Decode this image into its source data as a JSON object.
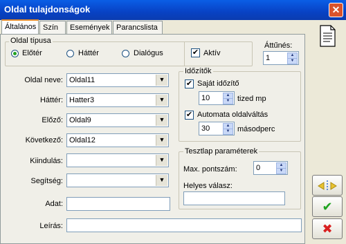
{
  "window": {
    "title": "Oldal tulajdonságok"
  },
  "tabs": [
    "Általános",
    "Szín",
    "Események",
    "Parancslista"
  ],
  "page_type": {
    "legend": "Oldal típusa",
    "options": [
      "Előtér",
      "Háttér",
      "Dialógus"
    ],
    "selected": "Előtér",
    "active_label": "Aktív"
  },
  "fade": {
    "label": "Áttűnés:",
    "value": "1"
  },
  "fields": {
    "page_name": {
      "label": "Oldal neve:",
      "value": "Oldal11"
    },
    "background": {
      "label": "Háttér:",
      "value": "Hatter3"
    },
    "previous": {
      "label": "Előző:",
      "value": "Oldal9"
    },
    "next": {
      "label": "Következő:",
      "value": "Oldal12"
    },
    "start": {
      "label": "Kiindulás:",
      "value": ""
    },
    "help": {
      "label": "Segítség:",
      "value": ""
    },
    "data": {
      "label": "Adat:",
      "value": ""
    },
    "description": {
      "label": "Leírás:",
      "value": ""
    }
  },
  "timers": {
    "legend": "Időzítők",
    "own_timer": {
      "label": "Saját időzítő",
      "checked": true,
      "value": "10",
      "unit": "tized mp"
    },
    "auto_page": {
      "label": "Automata oldalváltás",
      "checked": true,
      "value": "30",
      "unit": "másodperc"
    }
  },
  "test": {
    "legend": "Tesztlap paraméterek",
    "max_points_label": "Max. pontszám:",
    "max_points_value": "0",
    "correct_answer_label": "Helyes válasz:",
    "correct_answer_value": ""
  },
  "icons": {
    "page": "page-icon",
    "move": "move-arrows-icon",
    "ok": "checkmark-icon",
    "cancel": "cross-icon"
  }
}
